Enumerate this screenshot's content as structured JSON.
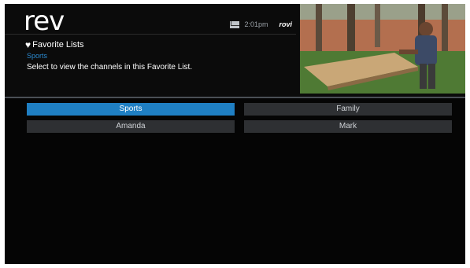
{
  "brand": {
    "logo": "rev",
    "provider": "rovi"
  },
  "status": {
    "time": "2:01pm",
    "mail_icon": "mail-icon"
  },
  "header": {
    "title": "Favorite Lists",
    "title_icon": "heart-icon",
    "current_list": "Sports",
    "instruction": "Select to view the channels in this Favorite List."
  },
  "lists": [
    {
      "label": "Sports",
      "selected": true
    },
    {
      "label": "Family",
      "selected": false
    },
    {
      "label": "Amanda",
      "selected": false
    },
    {
      "label": "Mark",
      "selected": false
    }
  ],
  "colors": {
    "accent": "#1f7fc3",
    "button": "#2e3033",
    "background": "#050505"
  }
}
